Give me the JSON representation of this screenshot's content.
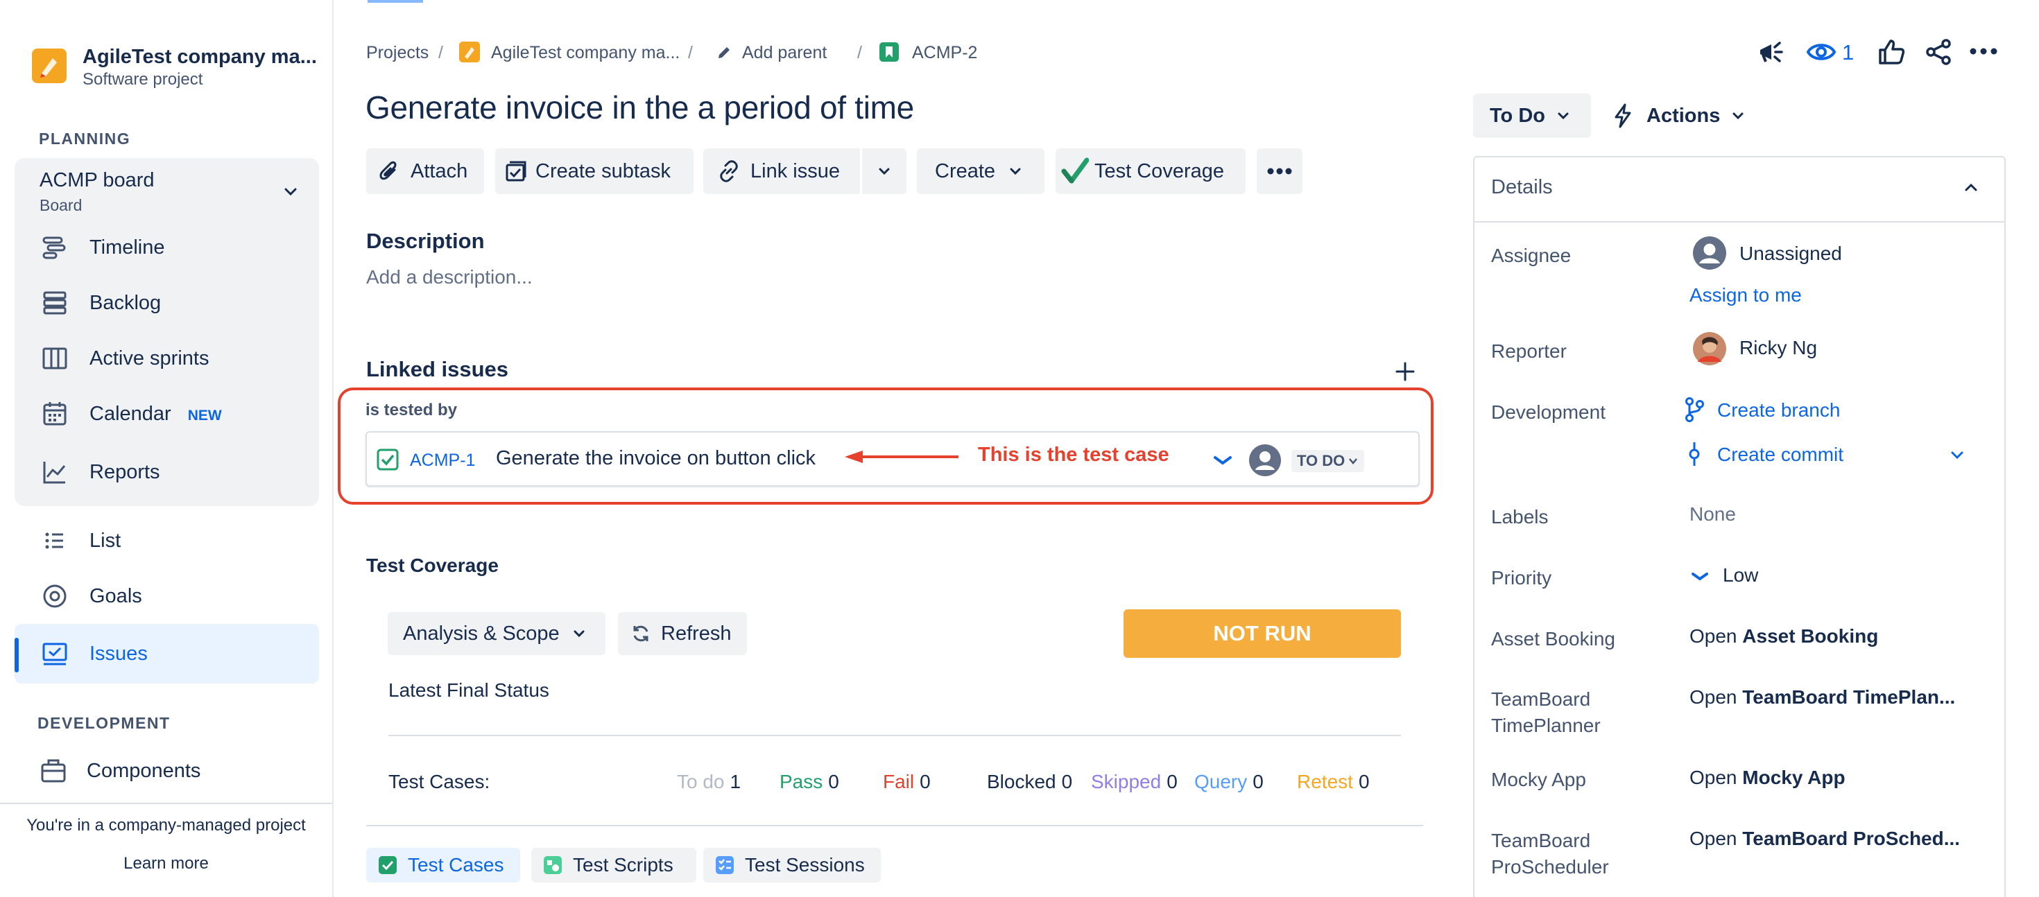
{
  "sidebar": {
    "project_name": "AgileTest company ma...",
    "project_type": "Software project",
    "planning_header": "PLANNING",
    "board_title": "ACMP board",
    "board_subtitle": "Board",
    "planning_items": [
      {
        "label": "Timeline",
        "icon": "timeline-icon"
      },
      {
        "label": "Backlog",
        "icon": "backlog-icon"
      },
      {
        "label": "Active sprints",
        "icon": "active-sprints-icon"
      },
      {
        "label": "Calendar",
        "icon": "calendar-icon",
        "badge": "NEW"
      },
      {
        "label": "Reports",
        "icon": "reports-icon"
      }
    ],
    "other_items": [
      {
        "label": "List",
        "icon": "list-icon"
      },
      {
        "label": "Goals",
        "icon": "goals-icon"
      },
      {
        "label": "Issues",
        "icon": "issues-icon",
        "active": true
      }
    ],
    "development_header": "DEVELOPMENT",
    "dev_items": [
      {
        "label": "Components",
        "icon": "components-icon"
      }
    ],
    "footer_text": "You're in a company-managed project",
    "footer_link": "Learn more"
  },
  "breadcrumb": {
    "projects": "Projects",
    "project": "AgileTest company ma...",
    "parent": "Add parent",
    "issue_key": "ACMP-2",
    "separator": "/"
  },
  "header_actions": {
    "watch_count": "1"
  },
  "issue": {
    "title": "Generate invoice in the a period of time"
  },
  "toolbar": {
    "attach": "Attach",
    "create_subtask": "Create subtask",
    "link_issue": "Link issue",
    "create": "Create",
    "test_coverage": "Test Coverage"
  },
  "description": {
    "heading": "Description",
    "placeholder": "Add a description..."
  },
  "linked_issues": {
    "heading": "Linked issues",
    "relation": "is tested by",
    "items": [
      {
        "key": "ACMP-1",
        "summary": "Generate the invoice on button click",
        "status": "TO DO"
      }
    ],
    "annotation": "This is the test case"
  },
  "test_coverage": {
    "heading": "Test Coverage",
    "scope_button": "Analysis & Scope",
    "refresh_button": "Refresh",
    "status": "NOT RUN",
    "latest_label": "Latest Final Status",
    "test_cases_label": "Test Cases:",
    "stats": [
      {
        "label": "To do",
        "value": "1",
        "color": "#b3b9c4"
      },
      {
        "label": "Pass",
        "value": "0",
        "color": "#22a06b"
      },
      {
        "label": "Fail",
        "value": "0",
        "color": "#e5412d"
      },
      {
        "label": "Blocked",
        "value": "0",
        "color": "#172b4d"
      },
      {
        "label": "Skipped",
        "value": "0",
        "color": "#8f7ee7"
      },
      {
        "label": "Query",
        "value": "0",
        "color": "#579dff"
      },
      {
        "label": "Retest",
        "value": "0",
        "color": "#f5a623"
      }
    ],
    "tabs": [
      "Test Cases",
      "Test Scripts",
      "Test Sessions"
    ]
  },
  "status_button": "To Do",
  "actions_button": "Actions",
  "details": {
    "heading": "Details",
    "assignee_label": "Assignee",
    "assignee_value": "Unassigned",
    "assign_to_me": "Assign to me",
    "reporter_label": "Reporter",
    "reporter_value": "Ricky Ng",
    "development_label": "Development",
    "create_branch": "Create branch",
    "create_commit": "Create commit",
    "labels_label": "Labels",
    "labels_value": "None",
    "priority_label": "Priority",
    "priority_value": "Low",
    "asset_booking_label": "Asset Booking",
    "asset_booking_open": "Open",
    "asset_booking_name": "Asset Booking",
    "teamboard_tp_label_1": "TeamBoard",
    "teamboard_tp_label_2": "TimePlanner",
    "teamboard_tp_open": "Open",
    "teamboard_tp_name": "TeamBoard TimePlan...",
    "mocky_label": "Mocky App",
    "mocky_open": "Open",
    "mocky_name": "Mocky App",
    "teamboard_ps_label_1": "TeamBoard",
    "teamboard_ps_label_2": "ProScheduler",
    "teamboard_ps_open": "Open",
    "teamboard_ps_name": "TeamBoard ProSched..."
  },
  "colors": {
    "accent": "#0c66e4",
    "annotation": "#e5412d",
    "not_run": "#f5ae3d"
  }
}
